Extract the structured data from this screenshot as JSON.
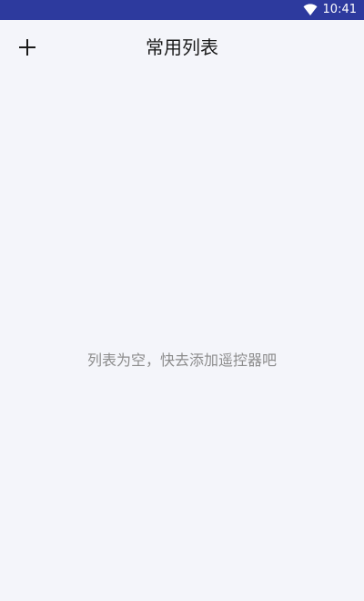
{
  "status_bar": {
    "time": "10:41",
    "icons": [
      "wifi-icon"
    ],
    "background": "#2d3a9e"
  },
  "app_bar": {
    "title": "常用列表",
    "add_icon": "plus-icon"
  },
  "main": {
    "empty_message": "列表为空，快去添加遥控器吧"
  },
  "colors": {
    "background": "#f4f5fa",
    "title_text": "#1a1a1a",
    "empty_text": "#8c8c8c"
  }
}
